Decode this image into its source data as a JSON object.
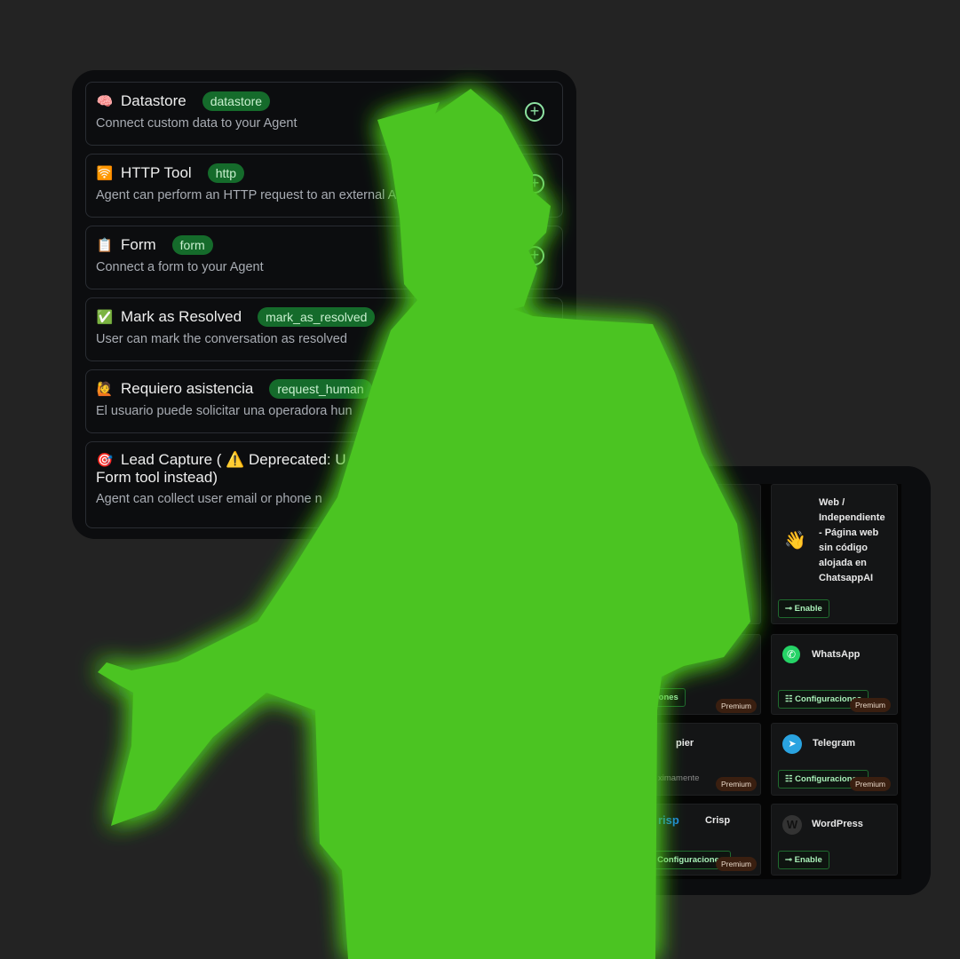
{
  "tools": [
    {
      "icon": "🧠",
      "name": "Datastore",
      "tag": "datastore",
      "desc": "Connect custom data to your Agent"
    },
    {
      "icon": "🛜",
      "name": "HTTP Tool",
      "tag": "http",
      "desc": "Agent can perform an HTTP request to an external A"
    },
    {
      "icon": "📋",
      "name": "Form",
      "tag": "form",
      "desc": "Connect a form to your Agent"
    },
    {
      "icon": "✅",
      "name": "Mark as Resolved",
      "tag": "mark_as_resolved",
      "desc": "User can mark the conversation as resolved"
    },
    {
      "icon": "🙋",
      "name": "Requiero asistencia",
      "tag": "request_human",
      "desc": "El usuario puede solicitar una operadora hun"
    },
    {
      "icon": "🎯",
      "name": "Lead Capture ( ⚠️ Deprecated: U",
      "name2": "Form tool instead)",
      "desc": "Agent can collect user email or phone n"
    }
  ],
  "integrations": {
    "web": {
      "name": "Web / Independiente - Página web sin código alojada en ChatsappAI",
      "button": "Enable"
    },
    "whatsapp": {
      "name": "WhatsApp",
      "button": "Configuraciones",
      "badge": "Premium"
    },
    "telegram": {
      "name": "Telegram",
      "button": "Configuraciones",
      "badge": "Premium"
    },
    "wordpress": {
      "name": "WordPress",
      "button": "Enable"
    },
    "left2": {
      "button": "iones",
      "badge": "Premium"
    },
    "left3": {
      "name": "pier",
      "status": "ximamente",
      "badge": "Premium"
    },
    "crisp": {
      "logo": "risp",
      "name": "Crisp",
      "button": "Configuraciones",
      "badge": "Premium"
    }
  },
  "colors": {
    "silhouette": "#4bc423",
    "tag_bg": "#156b2b",
    "panel": "#0c0d0f"
  }
}
